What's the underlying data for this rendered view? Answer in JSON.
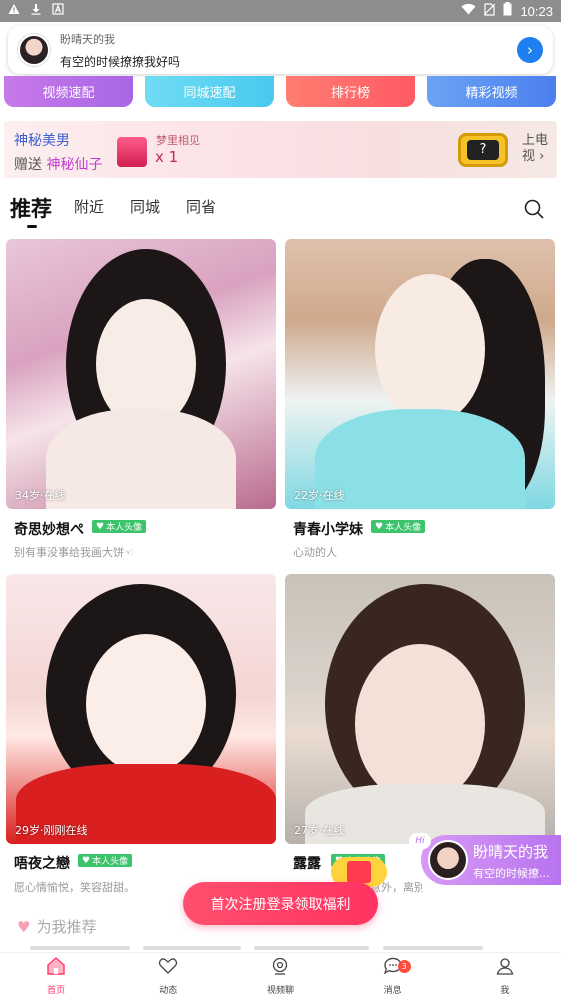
{
  "status_bar": {
    "time": "10:23"
  },
  "notification": {
    "name": "盼晴天的我",
    "message": "有空的时候撩撩我好吗"
  },
  "quick_actions": [
    "视频速配",
    "同城速配",
    "排行榜",
    "精彩视频"
  ],
  "promo": {
    "line1": "神秘美男",
    "line2_prefix": "赠送",
    "line2_highlight": "神秘仙子",
    "gift_title": "梦里相见",
    "gift_count": "x 1",
    "tv_mark": "?",
    "right_label": "上电视"
  },
  "tabs": [
    "推荐",
    "附近",
    "同城",
    "同省"
  ],
  "cards": [
    {
      "age_status": "34岁·在线",
      "name": "奇思妙想ぺ",
      "badge": "本人头像",
      "desc": "别有事没事给我画大饼☜"
    },
    {
      "age_status": "22岁·在线",
      "name": "青春小学妹",
      "badge": "本人头像",
      "desc": "心动的人"
    },
    {
      "age_status": "29岁·刚刚在线",
      "name": "唔夜之戀",
      "badge": "本人头像",
      "desc": "愿心情愉悦，笑容甜甜。"
    },
    {
      "age_status": "27岁·在线",
      "name": "露露",
      "badge": "本人头像",
      "desc": "生活中总有一些意外，离别的时候总护都着…"
    }
  ],
  "floating_card": {
    "hi": "Hi",
    "name": "盼晴天的我",
    "message": "有空的时候撩..."
  },
  "register_button": "首次注册登录领取福利",
  "recommend_header": "为我推荐",
  "bottom_nav": [
    {
      "label": "首页"
    },
    {
      "label": "动态"
    },
    {
      "label": "视频聊"
    },
    {
      "label": "消息",
      "badge": "3"
    },
    {
      "label": "我"
    }
  ]
}
